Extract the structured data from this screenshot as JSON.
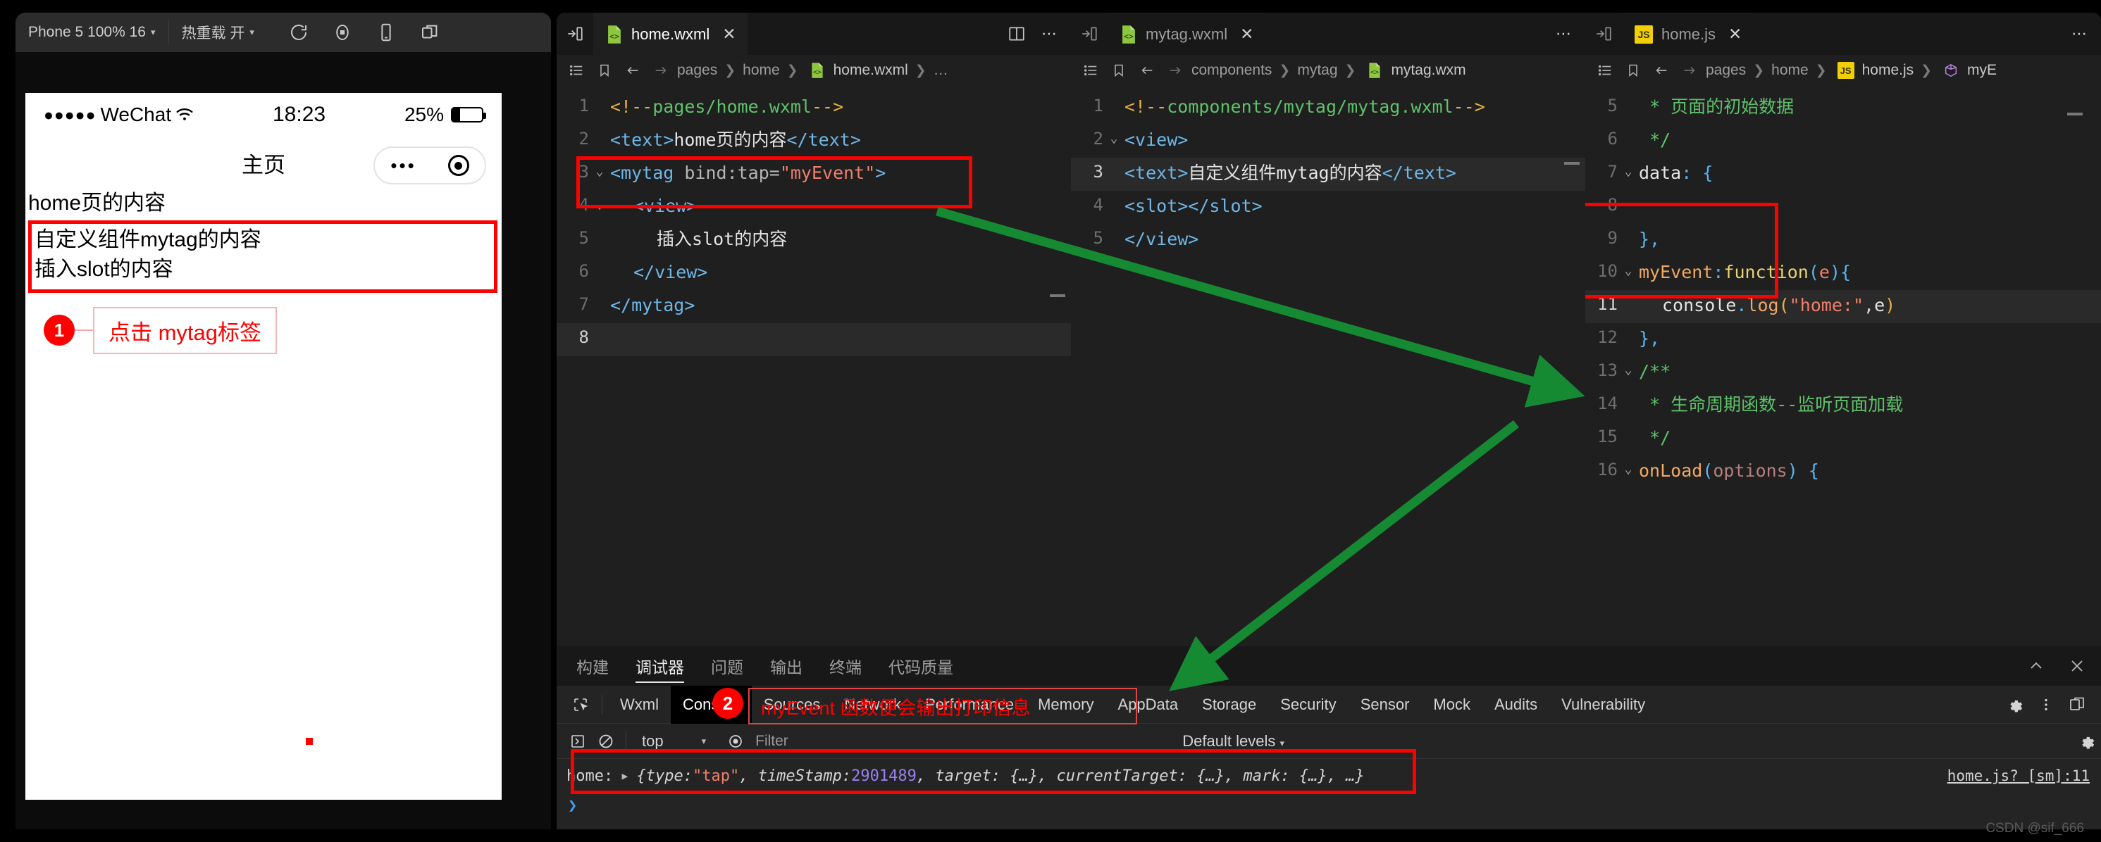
{
  "simulator": {
    "device_selector": "Phone 5 100% 16",
    "hotreload_selector": "热重载 开",
    "icons": [
      "refresh-icon",
      "record-icon",
      "device-icon",
      "multi-window-icon"
    ],
    "phone": {
      "status_bar": {
        "carrier_dots": "●●●●●",
        "carrier": "WeChat",
        "wifi": "wifi-icon",
        "time": "18:23",
        "battery_percent": "25%"
      },
      "nav_title": "主页",
      "capsule": {
        "more": "•••",
        "target": "target-icon"
      },
      "content_lines": [
        "home页的内容",
        "自定义组件mytag的内容",
        "插入slot的内容"
      ],
      "annotation": {
        "number": "1",
        "text": "点击 mytag标签"
      }
    }
  },
  "editors": [
    {
      "tab": {
        "label": "home.wxml",
        "icon": "wxml-file-icon",
        "close": "✕",
        "active": true
      },
      "tabbar_actions": [
        "split-editor-icon",
        "more-actions-icon"
      ],
      "breadcrumb": {
        "icons": [
          "outline-icon",
          "bookmark-icon",
          "back-arrow-icon",
          "forward-arrow-icon"
        ],
        "segments": [
          "pages",
          "home",
          "home.wxml",
          "…"
        ]
      },
      "lines": [
        {
          "n": "1",
          "fold": "",
          "indent": 0,
          "tokens": [
            {
              "t": "<!--",
              "c": "c-cbrk"
            },
            {
              "t": "pages/home.wxml",
              "c": "c-comment"
            },
            {
              "t": "-->",
              "c": "c-cbrk"
            }
          ]
        },
        {
          "n": "2",
          "fold": "",
          "indent": 0,
          "tokens": [
            {
              "t": "<text>",
              "c": "c-tag"
            },
            {
              "t": "home页的内容",
              "c": "c-txt"
            },
            {
              "t": "</text>",
              "c": "c-tag"
            }
          ]
        },
        {
          "n": "3",
          "fold": "⌄",
          "indent": 0,
          "tokens": [
            {
              "t": "<mytag",
              "c": "c-tag"
            },
            {
              "t": " bind:tap=",
              "c": "c-attr"
            },
            {
              "t": "\"myEvent\"",
              "c": "c-str"
            },
            {
              "t": ">",
              "c": "c-tag"
            }
          ]
        },
        {
          "n": "4",
          "fold": "⌄",
          "indent": 1,
          "tokens": [
            {
              "t": "<view>",
              "c": "c-tag"
            }
          ]
        },
        {
          "n": "5",
          "fold": "",
          "indent": 2,
          "tokens": [
            {
              "t": "插入slot的内容",
              "c": "c-txt"
            }
          ]
        },
        {
          "n": "6",
          "fold": "",
          "indent": 1,
          "tokens": [
            {
              "t": "</view>",
              "c": "c-tag"
            }
          ]
        },
        {
          "n": "7",
          "fold": "",
          "indent": 0,
          "tokens": [
            {
              "t": "</mytag>",
              "c": "c-tag"
            }
          ]
        },
        {
          "n": "8",
          "fold": "",
          "indent": 0,
          "highlight": true,
          "tokens": [
            {
              "t": "",
              "c": "c-txt"
            }
          ]
        }
      ]
    },
    {
      "tab": {
        "label": "mytag.wxml",
        "icon": "wxml-file-icon",
        "close": "✕",
        "active": false
      },
      "tabbar_actions": [
        "more-actions-icon"
      ],
      "breadcrumb": {
        "icons": [
          "outline-icon",
          "bookmark-icon",
          "back-arrow-icon",
          "forward-arrow-icon"
        ],
        "segments": [
          "components",
          "mytag",
          "mytag.wxm"
        ]
      },
      "lines": [
        {
          "n": "1",
          "fold": "",
          "indent": 0,
          "tokens": [
            {
              "t": "<!--",
              "c": "c-cbrk"
            },
            {
              "t": "components/mytag/mytag.wxml",
              "c": "c-comment"
            },
            {
              "t": "-->",
              "c": "c-cbrk"
            }
          ],
          "wrap": true
        },
        {
          "n": "2",
          "fold": "⌄",
          "indent": 0,
          "tokens": [
            {
              "t": "<view>",
              "c": "c-tag"
            }
          ]
        },
        {
          "n": "3",
          "fold": "",
          "indent": 0,
          "highlight": true,
          "tokens": [
            {
              "t": "<text>",
              "c": "c-tag"
            },
            {
              "t": "自定义组件mytag的内容",
              "c": "c-txt"
            },
            {
              "t": "</text>",
              "c": "c-tag"
            }
          ],
          "wrap": true
        },
        {
          "n": "4",
          "fold": "",
          "indent": 0,
          "tokens": [
            {
              "t": "<slot></slot>",
              "c": "c-tag"
            }
          ]
        },
        {
          "n": "5",
          "fold": "",
          "indent": 0,
          "tokens": [
            {
              "t": "</view>",
              "c": "c-tag"
            }
          ]
        }
      ]
    },
    {
      "tab": {
        "label": "home.js",
        "icon": "js-file-icon",
        "close": "✕",
        "active": false
      },
      "tabbar_actions": [
        "more-actions-icon"
      ],
      "breadcrumb": {
        "icons": [
          "outline-icon",
          "bookmark-icon",
          "back-arrow-icon",
          "forward-arrow-icon"
        ],
        "segments": [
          "pages",
          "home",
          "home.js",
          "myE"
        ]
      },
      "lines": [
        {
          "n": "5",
          "fold": "",
          "indent": 0,
          "tokens": [
            {
              "t": " * 页面的初始数据",
              "c": "c-comment"
            }
          ]
        },
        {
          "n": "6",
          "fold": "",
          "indent": 0,
          "tokens": [
            {
              "t": " */",
              "c": "c-comment"
            }
          ]
        },
        {
          "n": "7",
          "fold": "⌄",
          "indent": 0,
          "tokens": [
            {
              "t": "data",
              "c": "c-white"
            },
            {
              "t": ":",
              "c": "c-blue"
            },
            {
              "t": " ",
              "c": "c-punc"
            },
            {
              "t": "{",
              "c": "c-blue"
            }
          ]
        },
        {
          "n": "8",
          "fold": "",
          "indent": 0,
          "tokens": [
            {
              "t": "",
              "c": "c-txt"
            }
          ]
        },
        {
          "n": "9",
          "fold": "",
          "indent": 0,
          "tokens": [
            {
              "t": "},",
              "c": "c-blue"
            }
          ]
        },
        {
          "n": "10",
          "fold": "⌄",
          "indent": 0,
          "tokens": [
            {
              "t": "myEvent",
              "c": "c-key"
            },
            {
              "t": ":",
              "c": "c-blue"
            },
            {
              "t": "function",
              "c": "c-fn"
            },
            {
              "t": "(",
              "c": "c-blue"
            },
            {
              "t": "e",
              "c": "c-str"
            },
            {
              "t": ")",
              "c": "c-blue"
            },
            {
              "t": "{",
              "c": "c-blue"
            }
          ]
        },
        {
          "n": "11",
          "fold": "",
          "indent": 1,
          "highlight": true,
          "tokens": [
            {
              "t": "console",
              "c": "c-white"
            },
            {
              "t": ".",
              "c": "c-blue"
            },
            {
              "t": "log",
              "c": "c-key"
            },
            {
              "t": "(",
              "c": "c-cbrk"
            },
            {
              "t": "\"home:\"",
              "c": "c-str"
            },
            {
              "t": ",",
              "c": "c-punc"
            },
            {
              "t": "e",
              "c": "c-white"
            },
            {
              "t": ")",
              "c": "c-cbrk"
            }
          ]
        },
        {
          "n": "12",
          "fold": "",
          "indent": 0,
          "tokens": [
            {
              "t": "},",
              "c": "c-blue"
            }
          ]
        },
        {
          "n": "13",
          "fold": "⌄",
          "indent": 0,
          "tokens": [
            {
              "t": "/**",
              "c": "c-comment"
            }
          ]
        },
        {
          "n": "14",
          "fold": "",
          "indent": 0,
          "tokens": [
            {
              "t": " * 生命周期函数--监听页面加载",
              "c": "c-comment"
            }
          ]
        },
        {
          "n": "15",
          "fold": "",
          "indent": 0,
          "tokens": [
            {
              "t": " */",
              "c": "c-comment"
            }
          ]
        },
        {
          "n": "16",
          "fold": "⌄",
          "indent": 0,
          "tokens": [
            {
              "t": "onLoad",
              "c": "c-key"
            },
            {
              "t": "(",
              "c": "c-blue"
            },
            {
              "t": "options",
              "c": "c-param"
            },
            {
              "t": ")",
              "c": "c-blue"
            },
            {
              "t": " ",
              "c": "c-punc"
            },
            {
              "t": "{",
              "c": "c-blue"
            }
          ]
        }
      ]
    }
  ],
  "bottom_panel": {
    "tabs": [
      {
        "label": "构建",
        "active": false
      },
      {
        "label": "调试器",
        "active": true
      },
      {
        "label": "问题",
        "active": false
      },
      {
        "label": "输出",
        "active": false
      },
      {
        "label": "终端",
        "active": false
      },
      {
        "label": "代码质量",
        "active": false
      }
    ],
    "panel_actions": [
      "collapse-icon",
      "close-icon"
    ],
    "devtools": {
      "inspect_icon": "inspect-element-icon",
      "tabs": [
        {
          "label": "Wxml",
          "active": false
        },
        {
          "label": "Console",
          "active": true
        },
        {
          "label": "Sources",
          "active": false
        },
        {
          "label": "Network",
          "active": false
        },
        {
          "label": "Performance",
          "active": false
        },
        {
          "label": "Memory",
          "active": false
        },
        {
          "label": "AppData",
          "active": false
        },
        {
          "label": "Storage",
          "active": false
        },
        {
          "label": "Security",
          "active": false
        },
        {
          "label": "Sensor",
          "active": false
        },
        {
          "label": "Mock",
          "active": false
        },
        {
          "label": "Audits",
          "active": false
        },
        {
          "label": "Vulnerability",
          "active": false
        }
      ],
      "right_icons": [
        "settings-gear-icon",
        "kebab-menu-icon",
        "dock-side-icon"
      ],
      "filter_bar": {
        "execute_icon": "execute-icon",
        "clear_icon": "clear-console-icon",
        "context": "top",
        "eye_icon": "live-expression-icon",
        "filter_placeholder": "Filter",
        "levels": "Default levels",
        "settings_icon": "console-settings-icon"
      },
      "console_messages": [
        {
          "prefix": "home:",
          "expand_arrow": "▸",
          "body_open": "{type: ",
          "str_value": "\"tap\"",
          "body_mid": ", timeStamp: ",
          "num_value": "2901489",
          "body_end": ", target: {…}, currentTarget: {…}, mark: {…}, …}",
          "source": "home.js? [sm]:11"
        }
      ],
      "prompt": "❯"
    }
  },
  "annotations": {
    "two": {
      "number": "2",
      "text": "myEvent 函数便会输出打印信息"
    }
  },
  "watermark": "CSDN @sif_666",
  "colors": {
    "red_highlight": "#ff0000",
    "green_arrow": "#168a32",
    "editor_bg": "#1f1f1f",
    "tabbar_bg": "#181818",
    "panel_bg": "#242424"
  }
}
